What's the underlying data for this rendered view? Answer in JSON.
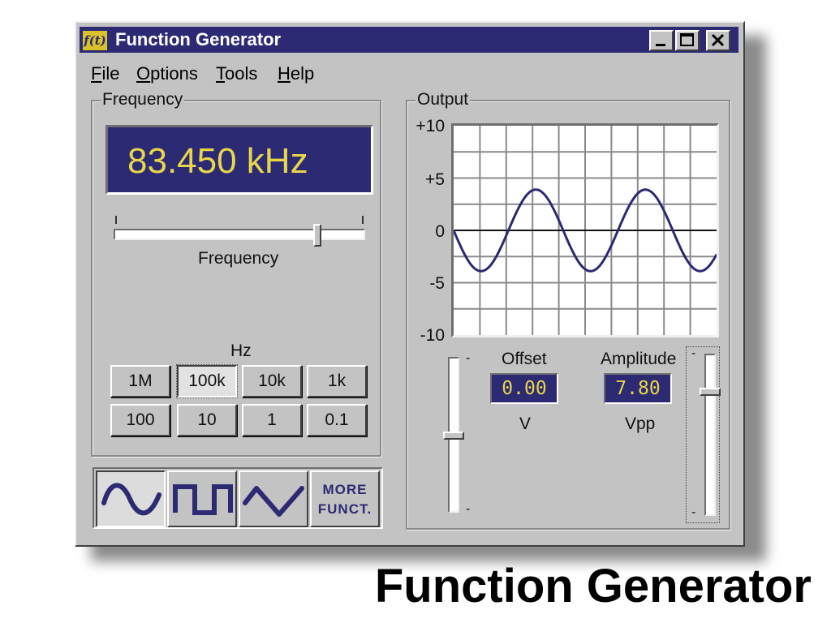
{
  "window": {
    "icon_text": "f(t)",
    "title": "Function Generator"
  },
  "menu": [
    {
      "label": "File",
      "mnemonic": "F",
      "rest": "ile"
    },
    {
      "label": "Options",
      "mnemonic": "O",
      "rest": "ptions"
    },
    {
      "label": "Tools",
      "mnemonic": "T",
      "rest": "ools"
    },
    {
      "label": "Help",
      "mnemonic": "H",
      "rest": "elp"
    }
  ],
  "frequency": {
    "group_label": "Frequency",
    "display": "83.450 kHz",
    "slider_label": "Frequency",
    "slider_fraction": 0.82,
    "units_label": "Hz",
    "range_buttons": [
      "1M",
      "100k",
      "10k",
      "1k",
      "100",
      "10",
      "1",
      "0.1"
    ],
    "selected_range": "100k"
  },
  "waveforms": {
    "buttons": [
      "sine-wave-icon",
      "square-wave-icon",
      "triangle-wave-icon"
    ],
    "selected": "sine",
    "more_line1": "MORE",
    "more_line2": "FUNCT."
  },
  "output": {
    "group_label": "Output",
    "y_ticks": [
      "+10",
      "+5",
      "0",
      "-5",
      "-10"
    ],
    "offset_label": "Offset",
    "offset_value": "0.00",
    "offset_unit": "V",
    "amplitude_label": "Amplitude",
    "amplitude_value": "7.80",
    "amplitude_unit": "Vpp",
    "offset_slider_fraction": 0.5,
    "amplitude_slider_fraction": 0.78
  },
  "caption": "Function Generator",
  "colors": {
    "title_bar": "#2b2a73",
    "lcd_background": "#2b2a73",
    "lcd_text": "#e8d64a",
    "trace": "#2b2a73",
    "window_face": "#c3c3c3"
  }
}
